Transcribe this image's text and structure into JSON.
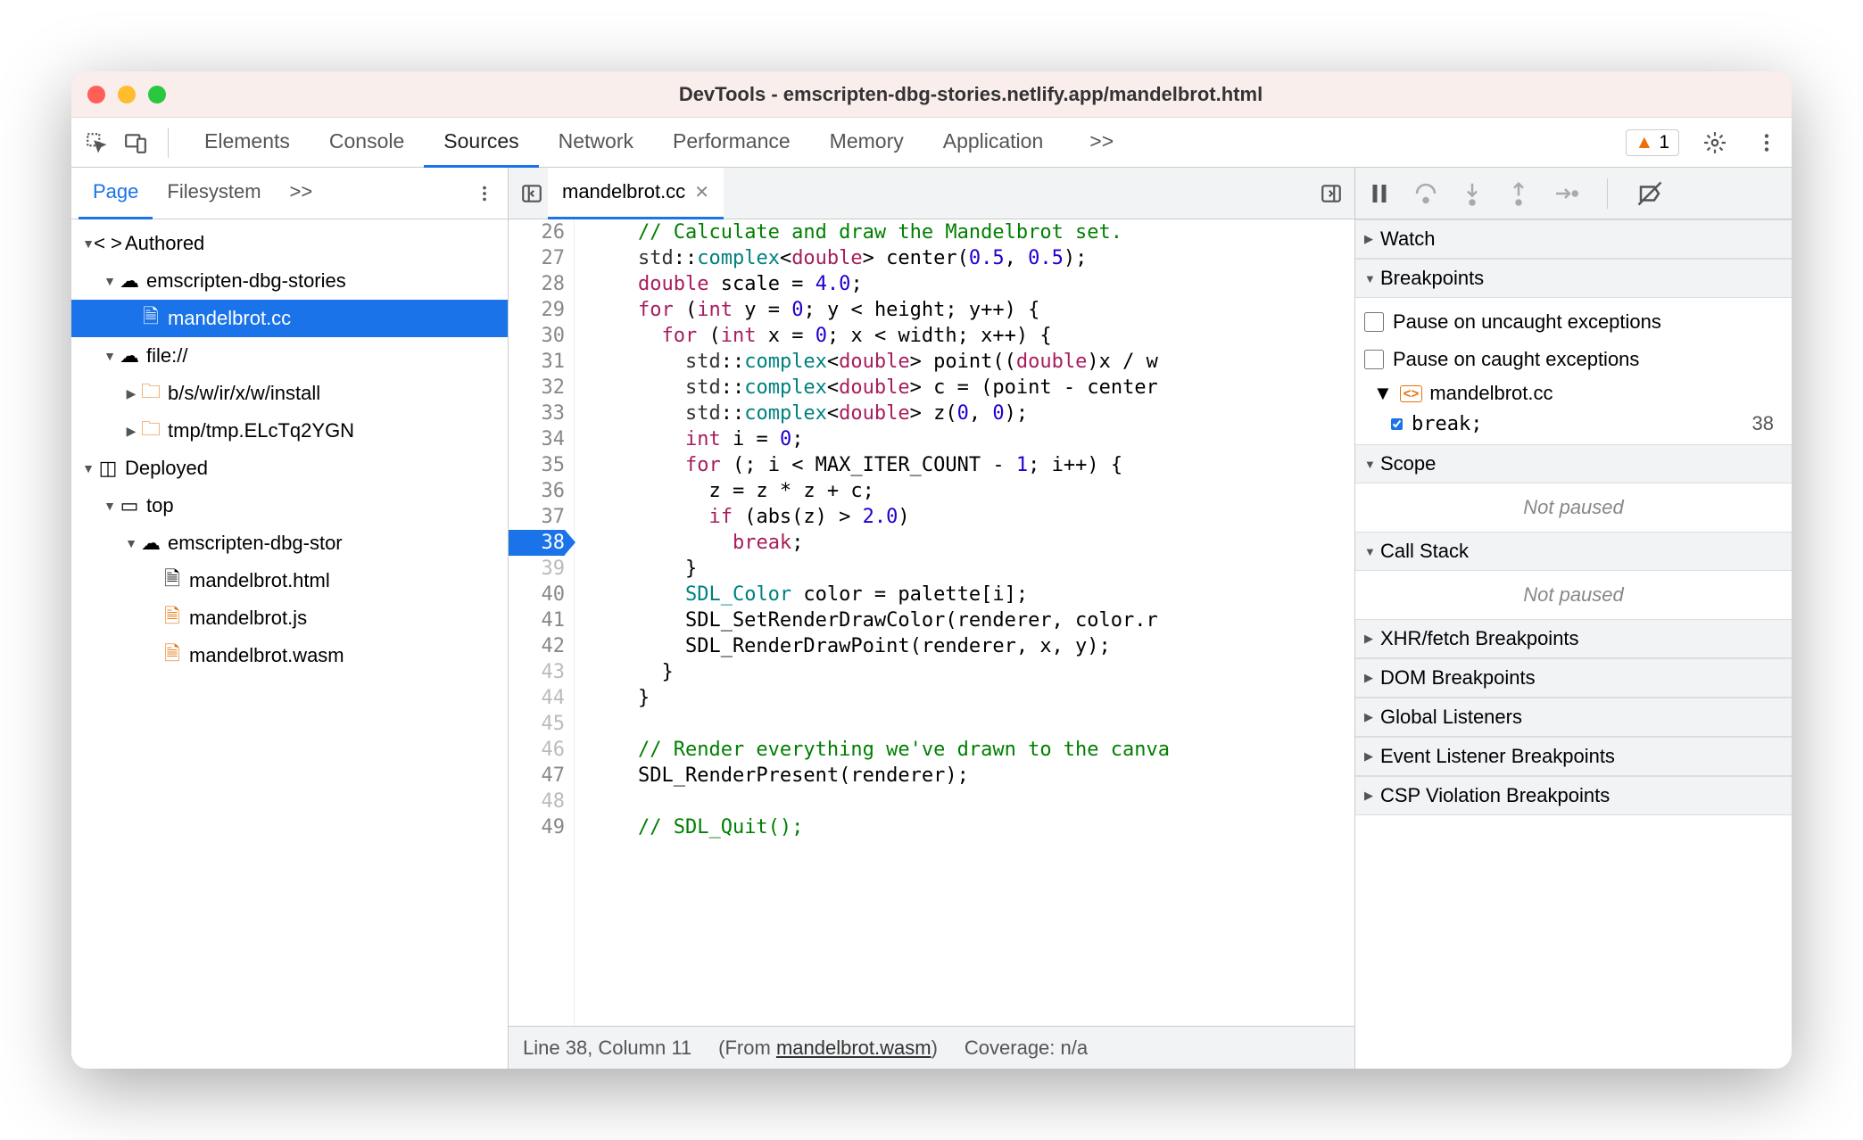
{
  "window": {
    "title": "DevTools - emscripten-dbg-stories.netlify.app/mandelbrot.html"
  },
  "topTabs": {
    "items": [
      "Elements",
      "Console",
      "Sources",
      "Network",
      "Performance",
      "Memory",
      "Application"
    ],
    "active": "Sources",
    "overflow": ">>",
    "warningCount": "1"
  },
  "leftTabs": {
    "items": [
      "Page",
      "Filesystem"
    ],
    "active": "Page",
    "overflow": ">>"
  },
  "tree": {
    "authored": "Authored",
    "domain": "emscripten-dbg-stories",
    "selectedFile": "mandelbrot.cc",
    "file_scheme": "file://",
    "folder1": "b/s/w/ir/x/w/install",
    "folder2": "tmp/tmp.ELcTq2YGN",
    "deployed": "Deployed",
    "top": "top",
    "domain2": "emscripten-dbg-stor",
    "f1": "mandelbrot.html",
    "f2": "mandelbrot.js",
    "f3": "mandelbrot.wasm"
  },
  "editor": {
    "filename": "mandelbrot.cc",
    "startLine": 26,
    "breakpointLine": 38,
    "dimLines": [
      39,
      43,
      44,
      45,
      46,
      48
    ],
    "lines": [
      {
        "n": 26,
        "tokens": [
          {
            "t": "    ",
            "c": ""
          },
          {
            "t": "// Calculate and draw the Mandelbrot set.",
            "c": "c-comment"
          }
        ]
      },
      {
        "n": 27,
        "tokens": [
          {
            "t": "    std",
            "c": "c-id"
          },
          {
            "t": "::",
            "c": ""
          },
          {
            "t": "complex",
            "c": "c-type"
          },
          {
            "t": "<",
            "c": ""
          },
          {
            "t": "double",
            "c": "c-kw"
          },
          {
            "t": "> center(",
            "c": ""
          },
          {
            "t": "0.5",
            "c": "c-num"
          },
          {
            "t": ", ",
            "c": ""
          },
          {
            "t": "0.5",
            "c": "c-num"
          },
          {
            "t": ");",
            "c": ""
          }
        ]
      },
      {
        "n": 28,
        "tokens": [
          {
            "t": "    ",
            "c": ""
          },
          {
            "t": "double",
            "c": "c-kw"
          },
          {
            "t": " scale = ",
            "c": ""
          },
          {
            "t": "4.0",
            "c": "c-num"
          },
          {
            "t": ";",
            "c": ""
          }
        ]
      },
      {
        "n": 29,
        "tokens": [
          {
            "t": "    ",
            "c": ""
          },
          {
            "t": "for",
            "c": "c-kw"
          },
          {
            "t": " (",
            "c": ""
          },
          {
            "t": "int",
            "c": "c-kw"
          },
          {
            "t": " y = ",
            "c": ""
          },
          {
            "t": "0",
            "c": "c-num"
          },
          {
            "t": "; y < height; y++) {",
            "c": ""
          }
        ]
      },
      {
        "n": 30,
        "tokens": [
          {
            "t": "      ",
            "c": ""
          },
          {
            "t": "for",
            "c": "c-kw"
          },
          {
            "t": " (",
            "c": ""
          },
          {
            "t": "int",
            "c": "c-kw"
          },
          {
            "t": " x = ",
            "c": ""
          },
          {
            "t": "0",
            "c": "c-num"
          },
          {
            "t": "; x < width; x++) {",
            "c": ""
          }
        ]
      },
      {
        "n": 31,
        "tokens": [
          {
            "t": "        std",
            "c": "c-id"
          },
          {
            "t": "::",
            "c": ""
          },
          {
            "t": "complex",
            "c": "c-type"
          },
          {
            "t": "<",
            "c": ""
          },
          {
            "t": "double",
            "c": "c-kw"
          },
          {
            "t": "> point((",
            "c": ""
          },
          {
            "t": "double",
            "c": "c-kw"
          },
          {
            "t": ")x / w",
            "c": ""
          }
        ]
      },
      {
        "n": 32,
        "tokens": [
          {
            "t": "        std",
            "c": "c-id"
          },
          {
            "t": "::",
            "c": ""
          },
          {
            "t": "complex",
            "c": "c-type"
          },
          {
            "t": "<",
            "c": ""
          },
          {
            "t": "double",
            "c": "c-kw"
          },
          {
            "t": "> c = (point - center",
            "c": ""
          }
        ]
      },
      {
        "n": 33,
        "tokens": [
          {
            "t": "        std",
            "c": "c-id"
          },
          {
            "t": "::",
            "c": ""
          },
          {
            "t": "complex",
            "c": "c-type"
          },
          {
            "t": "<",
            "c": ""
          },
          {
            "t": "double",
            "c": "c-kw"
          },
          {
            "t": "> z(",
            "c": ""
          },
          {
            "t": "0",
            "c": "c-num"
          },
          {
            "t": ", ",
            "c": ""
          },
          {
            "t": "0",
            "c": "c-num"
          },
          {
            "t": ");",
            "c": ""
          }
        ]
      },
      {
        "n": 34,
        "tokens": [
          {
            "t": "        ",
            "c": ""
          },
          {
            "t": "int",
            "c": "c-kw"
          },
          {
            "t": " i = ",
            "c": ""
          },
          {
            "t": "0",
            "c": "c-num"
          },
          {
            "t": ";",
            "c": ""
          }
        ]
      },
      {
        "n": 35,
        "tokens": [
          {
            "t": "        ",
            "c": ""
          },
          {
            "t": "for",
            "c": "c-kw"
          },
          {
            "t": " (; i < MAX_ITER_COUNT - ",
            "c": ""
          },
          {
            "t": "1",
            "c": "c-num"
          },
          {
            "t": "; i++) {",
            "c": ""
          }
        ]
      },
      {
        "n": 36,
        "tokens": [
          {
            "t": "          z = z * z + c;",
            "c": ""
          }
        ]
      },
      {
        "n": 37,
        "tokens": [
          {
            "t": "          ",
            "c": ""
          },
          {
            "t": "if",
            "c": "c-kw"
          },
          {
            "t": " (abs(z) > ",
            "c": ""
          },
          {
            "t": "2.0",
            "c": "c-num"
          },
          {
            "t": ")",
            "c": ""
          }
        ]
      },
      {
        "n": 38,
        "tokens": [
          {
            "t": "            ",
            "c": ""
          },
          {
            "t": "break",
            "c": "c-kw"
          },
          {
            "t": ";",
            "c": ""
          }
        ]
      },
      {
        "n": 39,
        "tokens": [
          {
            "t": "        }",
            "c": ""
          }
        ]
      },
      {
        "n": 40,
        "tokens": [
          {
            "t": "        ",
            "c": ""
          },
          {
            "t": "SDL_Color",
            "c": "c-type"
          },
          {
            "t": " color = palette[i];",
            "c": ""
          }
        ]
      },
      {
        "n": 41,
        "tokens": [
          {
            "t": "        SDL_SetRenderDrawColor(renderer, color.r",
            "c": ""
          }
        ]
      },
      {
        "n": 42,
        "tokens": [
          {
            "t": "        SDL_RenderDrawPoint(renderer, x, y);",
            "c": ""
          }
        ]
      },
      {
        "n": 43,
        "tokens": [
          {
            "t": "      }",
            "c": ""
          }
        ]
      },
      {
        "n": 44,
        "tokens": [
          {
            "t": "    }",
            "c": ""
          }
        ]
      },
      {
        "n": 45,
        "tokens": [
          {
            "t": "",
            "c": ""
          }
        ]
      },
      {
        "n": 46,
        "tokens": [
          {
            "t": "    ",
            "c": ""
          },
          {
            "t": "// Render everything we've drawn to the canva",
            "c": "c-comment"
          }
        ]
      },
      {
        "n": 47,
        "tokens": [
          {
            "t": "    SDL_RenderPresent(renderer);",
            "c": ""
          }
        ]
      },
      {
        "n": 48,
        "tokens": [
          {
            "t": "",
            "c": ""
          }
        ]
      },
      {
        "n": 49,
        "tokens": [
          {
            "t": "    ",
            "c": ""
          },
          {
            "t": "// SDL_Quit();",
            "c": "c-comment"
          }
        ]
      }
    ]
  },
  "statusbar": {
    "pos": "Line 38, Column 11",
    "fromPrefix": "(From ",
    "fromFile": "mandelbrot.wasm",
    "fromSuffix": ")",
    "coverage": "Coverage: n/a"
  },
  "debugger": {
    "sections": {
      "watch": "Watch",
      "breakpoints": "Breakpoints",
      "scope": "Scope",
      "callstack": "Call Stack",
      "xhr": "XHR/fetch Breakpoints",
      "dom": "DOM Breakpoints",
      "global": "Global Listeners",
      "event": "Event Listener Breakpoints",
      "csp": "CSP Violation Breakpoints"
    },
    "pauseUncaught": "Pause on uncaught exceptions",
    "pauseCaught": "Pause on caught exceptions",
    "bpFile": "mandelbrot.cc",
    "bpCode": "break;",
    "bpLine": "38",
    "notPaused": "Not paused"
  }
}
